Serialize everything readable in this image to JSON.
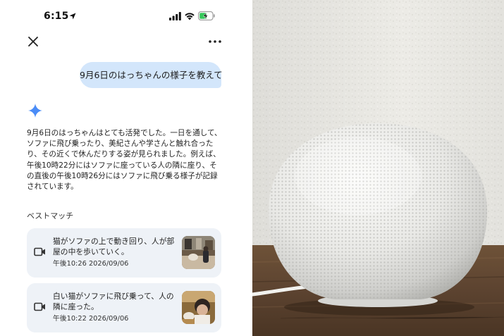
{
  "status_bar": {
    "time": "6:15"
  },
  "chat": {
    "user_message": "9月6日のはっちゃんの様子を教えて",
    "answer": "9月6日のはっちゃんはとても活発でした。一日を通して、ソファに飛び乗ったり、美紀さんや学さんと触れ合ったり、その近くで休んだりする姿が見られました。例えば、午後10時22分にはソファに座っている人の隣に座り、その直後の午後10時26分にはソファに飛び乗る様子が記録されています。"
  },
  "best_match": {
    "title": "ベストマッチ",
    "items": [
      {
        "description": "猫がソファの上で動き回り、人が部屋の中を歩いていく。",
        "time": "午後10:26 2026/09/06"
      },
      {
        "description": "白い猫がソファに飛び乗って、人の隣に座った。",
        "time": "午後10:22 2026/09/06"
      }
    ]
  },
  "icons": {
    "close": "close-icon",
    "more": "more-horizontal-icon",
    "assistant": "sparkle-icon",
    "clip": "video-camera-icon"
  },
  "colors": {
    "user_bubble": "#d3e6fb",
    "sparkle": "#4a8cf7",
    "card_bg": "#eef2f7",
    "battery_green": "#34c759"
  }
}
